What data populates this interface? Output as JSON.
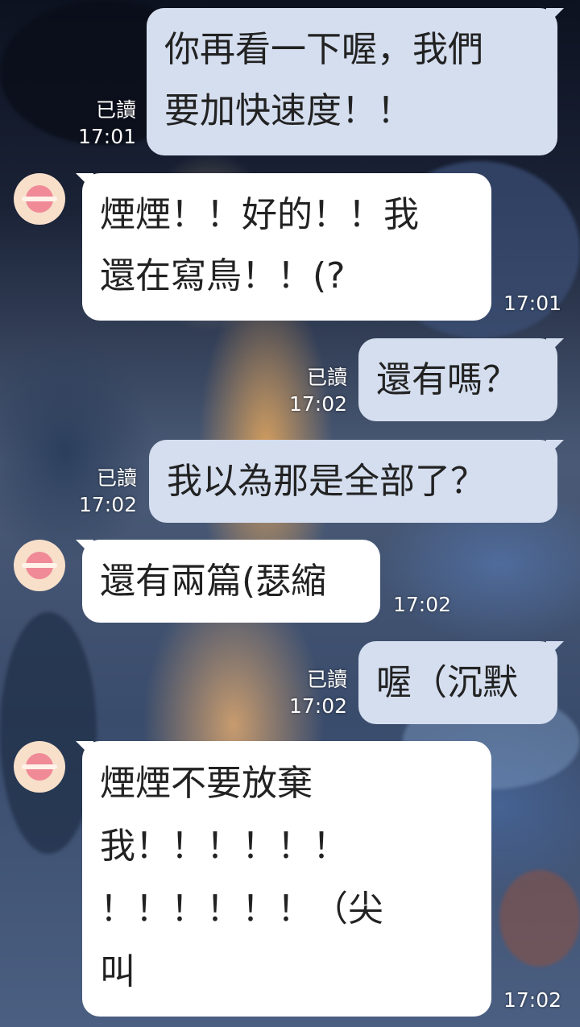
{
  "colors": {
    "outgoing_bubble": "#d4deef",
    "incoming_bubble": "#ffffff",
    "avatar_bg": "#f7dfca",
    "avatar_planet": "#ef8a96"
  },
  "messages": [
    {
      "direction": "outgoing",
      "text": "你再看一下喔，我們\n要加快速度！！",
      "read": "已讀",
      "time": "17:01"
    },
    {
      "direction": "incoming",
      "text": "煙煙！！好的！！我\n還在寫鳥！！(?",
      "time": "17:01",
      "avatar_icon": "planet-icon"
    },
    {
      "direction": "outgoing",
      "text": "還有嗎？",
      "read": "已讀",
      "time": "17:02"
    },
    {
      "direction": "outgoing",
      "text": "我以為那是全部了？",
      "read": "已讀",
      "time": "17:02"
    },
    {
      "direction": "incoming",
      "text": "還有兩篇(瑟縮",
      "time": "17:02",
      "avatar_icon": "planet-icon"
    },
    {
      "direction": "outgoing",
      "text": "喔（沉默",
      "read": "已讀",
      "time": "17:02"
    },
    {
      "direction": "incoming",
      "text": "煙煙不要放棄\n我！！！！！！\n！！！！！！（尖\n叫",
      "time": "17:02",
      "avatar_icon": "planet-icon"
    }
  ]
}
